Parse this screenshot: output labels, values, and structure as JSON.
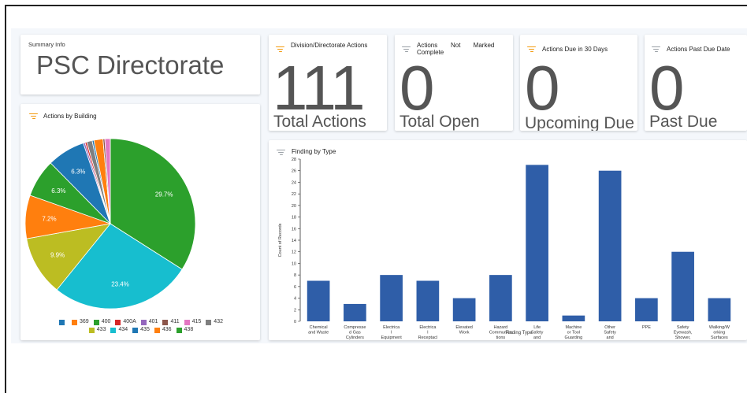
{
  "summary": {
    "title": "Summary Info",
    "value": "PSC Directorate"
  },
  "kpis": [
    {
      "title": "Division/Directorate Actions",
      "value": "111",
      "label": "Total Actions",
      "icon": "filter-orange"
    },
    {
      "title": "Actions Complete",
      "title_extra": "Not Marked",
      "value": "0",
      "label": "Total Open",
      "icon": "filter-grey"
    },
    {
      "title": "Actions Due in 30 Days",
      "value": "0",
      "label": "Upcoming Due",
      "icon": "filter-orange"
    },
    {
      "title": "Actions Past Due Date",
      "value": "0",
      "label": "Past Due",
      "icon": "filter-grey"
    }
  ],
  "pie_card": {
    "title": "Actions by Building"
  },
  "bar_card": {
    "title": "Finding by Type"
  },
  "chart_data": [
    {
      "type": "pie",
      "slices": [
        {
          "label": "",
          "value": 0.3,
          "color": "#1f77b4",
          "pct_label": ""
        },
        {
          "label": "369",
          "value": 1.5,
          "color": "#ff7f0e",
          "pct_label": ""
        },
        {
          "label": "400",
          "value": 29.7,
          "color": "#2ca02c",
          "pct_label": "29.7%"
        },
        {
          "label": "400A",
          "value": 0.3,
          "color": "#d62728",
          "pct_label": ""
        },
        {
          "label": "401",
          "value": 0.3,
          "color": "#9467bd",
          "pct_label": ""
        },
        {
          "label": "411",
          "value": 0.3,
          "color": "#8c564b",
          "pct_label": ""
        },
        {
          "label": "415",
          "value": 0.9,
          "color": "#e377c2",
          "pct_label": ""
        },
        {
          "label": "432",
          "value": 0.9,
          "color": "#7f7f7f",
          "pct_label": ""
        },
        {
          "label": "433",
          "value": 9.9,
          "color": "#bcbd22",
          "pct_label": "9.9%"
        },
        {
          "label": "434",
          "value": 23.4,
          "color": "#17becf",
          "pct_label": "23.4%"
        },
        {
          "label": "435",
          "value": 6.3,
          "color": "#1f77b4",
          "pct_label": "6.3%"
        },
        {
          "label": "436",
          "value": 7.2,
          "color": "#ff7f0e",
          "pct_label": "7.2%"
        },
        {
          "label": "438",
          "value": 6.3,
          "color": "#2ca02c",
          "pct_label": "6.3%"
        }
      ],
      "display_order": [
        2,
        9,
        8,
        11,
        12,
        10,
        4,
        3,
        7,
        0,
        1,
        5,
        6
      ],
      "legend_rows": [
        [
          0,
          1,
          2,
          3,
          4,
          5,
          6,
          7
        ],
        [
          8,
          9,
          10,
          11,
          12
        ]
      ]
    },
    {
      "type": "bar",
      "categories": [
        [
          "Chemical",
          "and Waste"
        ],
        [
          "Compresse",
          "d Gas",
          "Cylinders"
        ],
        [
          "Electrica",
          "l",
          "Equipment"
        ],
        [
          "Electrica",
          "l",
          "Receptacl"
        ],
        [
          "Elevated",
          "Work"
        ],
        [
          "Hazard",
          "Communica",
          "tions"
        ],
        [
          "Life",
          "Safety",
          "and"
        ],
        [
          "Machine",
          "or Tool",
          "Guarding"
        ],
        [
          "Other",
          "Safety",
          "and"
        ],
        [
          "PPE"
        ],
        [
          "Safety",
          "Eyewash,",
          "Shower,"
        ],
        [
          "Walking/W",
          "orking",
          "Surfaces"
        ]
      ],
      "values": [
        7,
        3,
        8,
        7,
        4,
        8,
        27,
        1,
        26,
        4,
        12,
        4
      ],
      "ylabel": "Count of Records",
      "xlabel": "Finding Type",
      "ylim": [
        0,
        28
      ],
      "yticks": [
        0,
        2,
        4,
        6,
        8,
        10,
        12,
        14,
        16,
        18,
        20,
        22,
        24,
        26,
        28
      ],
      "bar_color": "#2f5ea8"
    }
  ]
}
